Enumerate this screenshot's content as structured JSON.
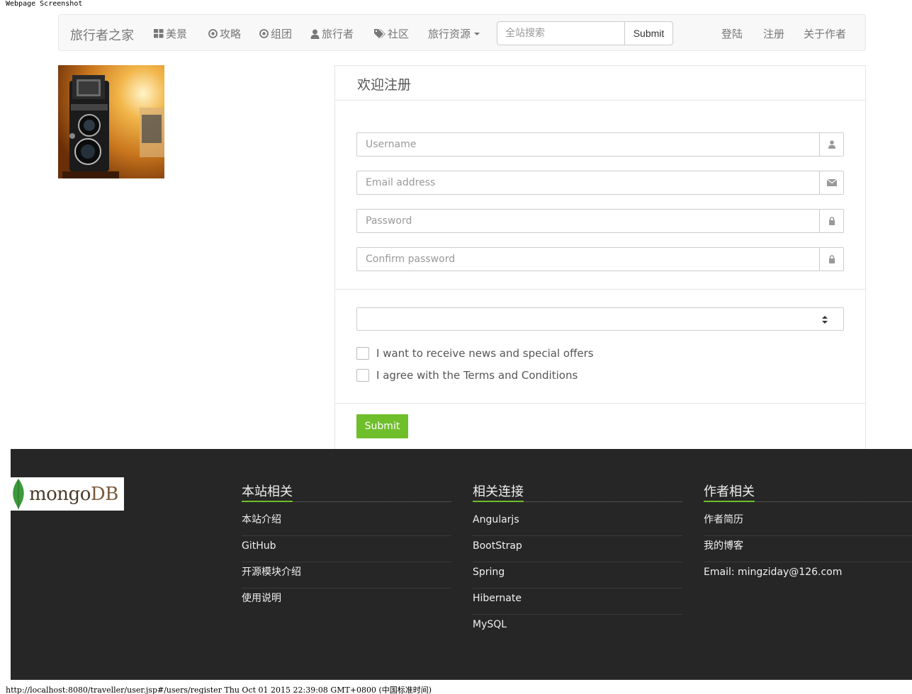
{
  "screenshot_label": "Webpage Screenshot",
  "navbar": {
    "brand": "旅行者之家",
    "items": [
      {
        "label": "美景",
        "icon": "grid-icon"
      },
      {
        "label": "攻略",
        "icon": "target-icon"
      },
      {
        "label": "组团",
        "icon": "target-icon"
      },
      {
        "label": "旅行者",
        "icon": "user-icon"
      },
      {
        "label": "社区",
        "icon": "tags-icon"
      },
      {
        "label": "旅行资源",
        "icon": "caret-down-icon"
      }
    ],
    "search_placeholder": "全站搜索",
    "search_button": "Submit",
    "right_links": [
      "登陆",
      "注册",
      "关于作者"
    ]
  },
  "register": {
    "title": "欢迎注册",
    "username_placeholder": "Username",
    "email_placeholder": "Email address",
    "password_placeholder": "Password",
    "confirm_placeholder": "Confirm password",
    "select_value": "",
    "news_label": "I want to receive news and special offers",
    "terms_label": "I agree with the Terms and Conditions",
    "submit_label": "Submit"
  },
  "footer": {
    "logo_text_a": "mongo",
    "logo_text_b": "DB",
    "columns": [
      {
        "title": "本站相关",
        "items": [
          "本站介绍",
          "GitHub",
          "开源模块介绍",
          "使用说明"
        ]
      },
      {
        "title": "相关连接",
        "items": [
          "Angularjs",
          "BootStrap",
          "Spring",
          "Hibernate",
          "MySQL"
        ]
      },
      {
        "title": "作者相关",
        "items": [
          "作者简历",
          "我的博客",
          "Email: mingziday@126.com"
        ]
      }
    ]
  },
  "status_bar": "http://localhost:8080/traveller/user.jsp#/users/register Thu Oct 01 2015 22:39:08 GMT+0800 (中国标准时间)",
  "colors": {
    "accent": "#6fbe2b",
    "footer_bg": "#262626",
    "navbar_bg": "#f8f8f8"
  }
}
